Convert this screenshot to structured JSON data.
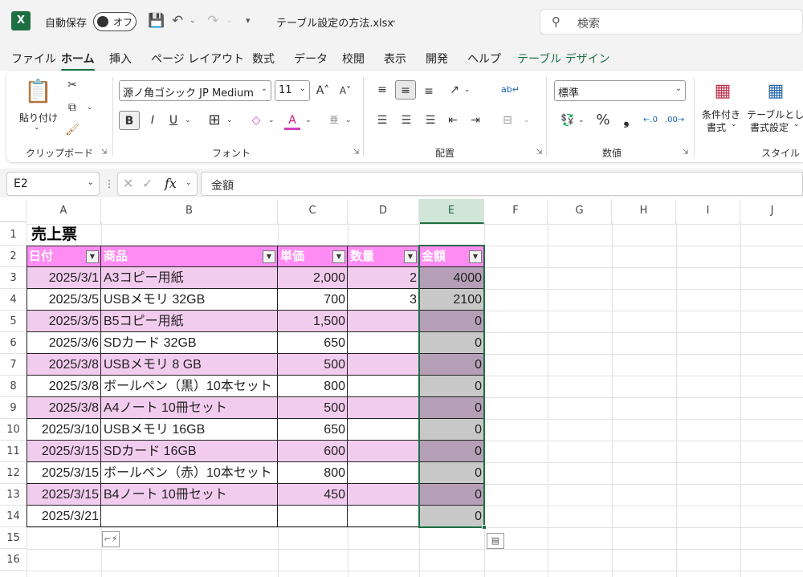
{
  "titlebar": {
    "autosave_label": "自動保存",
    "autosave_state": "オフ",
    "filename": "テーブル設定の方法.xlsx",
    "search_placeholder": "検索"
  },
  "tabs": [
    "ファイル",
    "ホーム",
    "挿入",
    "ページ レイアウト",
    "数式",
    "データ",
    "校閲",
    "表示",
    "開発",
    "ヘルプ",
    "テーブル デザイン"
  ],
  "ribbon": {
    "clipboard": {
      "paste_label": "貼り付け",
      "group_label": "クリップボード"
    },
    "font": {
      "font_name": "源ノ角ゴシック JP Medium",
      "font_size": "11",
      "group_label": "フォント",
      "bold": "B",
      "italic": "I",
      "underline": "U"
    },
    "alignment": {
      "group_label": "配置"
    },
    "number": {
      "format": "標準",
      "group_label": "数値"
    },
    "styles": {
      "conditional_label_1": "条件付き",
      "conditional_label_2": "書式",
      "table_label_1": "テーブルとして",
      "table_label_2": "書式設定",
      "group_label": "スタイル"
    }
  },
  "formula_bar": {
    "name_box": "E2",
    "fx": "fx",
    "formula": "金額"
  },
  "columns": [
    "A",
    "B",
    "C",
    "D",
    "E",
    "F",
    "G",
    "H",
    "I",
    "J"
  ],
  "rows": [
    "1",
    "2",
    "3",
    "4",
    "5",
    "6",
    "7",
    "8",
    "9",
    "10",
    "11",
    "12",
    "13",
    "14",
    "15",
    "16"
  ],
  "sheet": {
    "title": "売上票",
    "headers": [
      "日付",
      "商品",
      "単価",
      "数量",
      "金額"
    ],
    "data": [
      [
        "2025/3/1",
        "A3コピー用紙",
        "2,000",
        "2",
        "4000"
      ],
      [
        "2025/3/5",
        "USBメモリ 32GB",
        "700",
        "3",
        "2100"
      ],
      [
        "2025/3/5",
        "B5コピー用紙",
        "1,500",
        "",
        "0"
      ],
      [
        "2025/3/6",
        "SDカード 32GB",
        "650",
        "",
        "0"
      ],
      [
        "2025/3/8",
        "USBメモリ 8 GB",
        "500",
        "",
        "0"
      ],
      [
        "2025/3/8",
        "ボールペン（黒）10本セット",
        "800",
        "",
        "0"
      ],
      [
        "2025/3/8",
        "A4ノート 10冊セット",
        "500",
        "",
        "0"
      ],
      [
        "2025/3/10",
        "USBメモリ 16GB",
        "650",
        "",
        "0"
      ],
      [
        "2025/3/15",
        "SDカード 16GB",
        "600",
        "",
        "0"
      ],
      [
        "2025/3/15",
        "ボールペン（赤）10本セット",
        "800",
        "",
        "0"
      ],
      [
        "2025/3/15",
        "B4ノート 10冊セット",
        "450",
        "",
        "0"
      ],
      [
        "2025/3/21",
        "",
        "",
        "",
        "0"
      ]
    ]
  },
  "colors": {
    "header_fill": "#ff8cf2",
    "band_fill": "#f2ccee",
    "calc_band": "#b59fb6",
    "calc_plain": "#c8c8c8",
    "accent": "#1d6f42"
  }
}
